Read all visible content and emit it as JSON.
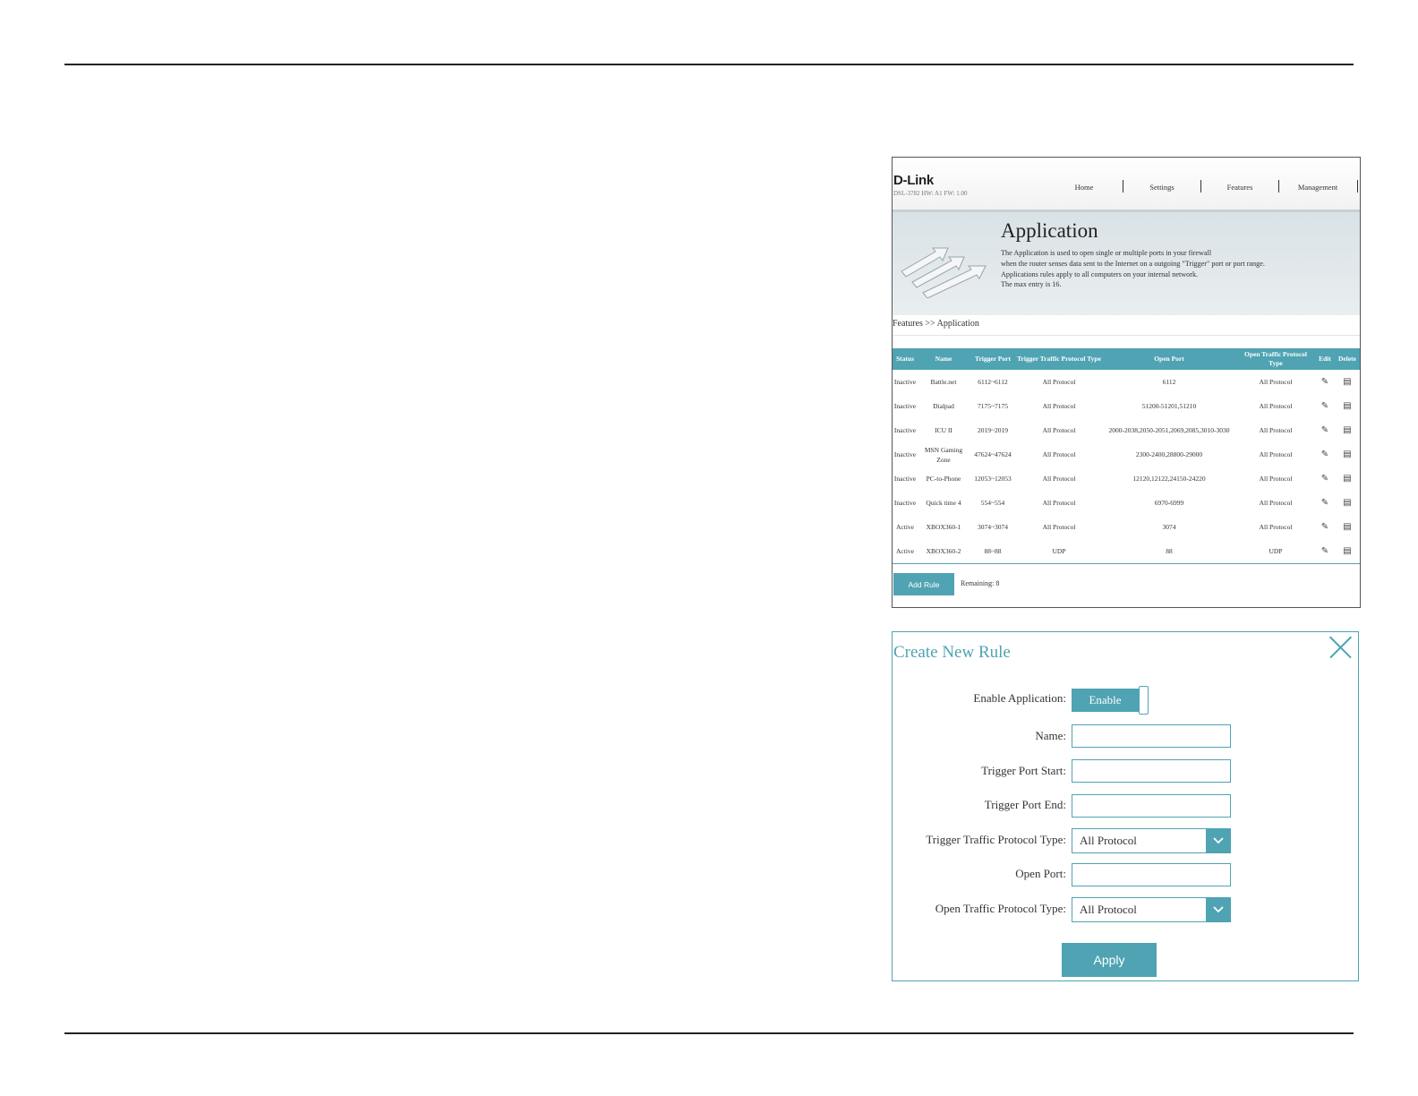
{
  "router": {
    "logo": "D-Link",
    "model": "DSL-3782  HW: A1  FW: 1.00",
    "nav": [
      "Home",
      "Settings",
      "Features",
      "Management"
    ],
    "hero_title": "Application",
    "hero_desc": [
      "The Application is used to open single or multiple ports in your firewall",
      "when the router senses data sent to the Internet on a outgoing \"Trigger\" port or port range.",
      "Applications rules apply to all computers on your internal network.",
      "The max entry is 16."
    ],
    "breadcrumb": "Features >> Application",
    "columns": [
      "Status",
      "Name",
      "Trigger Port",
      "Trigger Traffic Protocol Type",
      "Open Port",
      "Open Traffic Protocol Type",
      "Edit",
      "Delete"
    ],
    "rows": [
      {
        "status": "Inactive",
        "name": "Battle.net",
        "trigger_port": "6112~6112",
        "trigger_proto": "All Protocol",
        "open_port": "6112",
        "open_proto": "All Protocol"
      },
      {
        "status": "Inactive",
        "name": "Dialpad",
        "trigger_port": "7175~7175",
        "trigger_proto": "All Protocol",
        "open_port": "51200-51201,51210",
        "open_proto": "All Protocol"
      },
      {
        "status": "Inactive",
        "name": "ICU II",
        "trigger_port": "2019~2019",
        "trigger_proto": "All Protocol",
        "open_port": "2000-2038,2050-2051,2069,2085,3010-3030",
        "open_proto": "All Protocol"
      },
      {
        "status": "Inactive",
        "name": "MSN Gaming Zone",
        "trigger_port": "47624~47624",
        "trigger_proto": "All Protocol",
        "open_port": "2300-2400,28800-29000",
        "open_proto": "All Protocol"
      },
      {
        "status": "Inactive",
        "name": "PC-to-Phone",
        "trigger_port": "12053~12053",
        "trigger_proto": "All Protocol",
        "open_port": "12120,12122,24150-24220",
        "open_proto": "All Protocol"
      },
      {
        "status": "Inactive",
        "name": "Quick time 4",
        "trigger_port": "554~554",
        "trigger_proto": "All Protocol",
        "open_port": "6970-6999",
        "open_proto": "All Protocol"
      },
      {
        "status": "Active",
        "name": "XBOX360-1",
        "trigger_port": "3074~3074",
        "trigger_proto": "All Protocol",
        "open_port": "3074",
        "open_proto": "All Protocol"
      },
      {
        "status": "Active",
        "name": "XBOX360-2",
        "trigger_port": "88~88",
        "trigger_proto": "UDP",
        "open_port": "88",
        "open_proto": "UDP"
      }
    ],
    "add_rule_label": "Add Rule",
    "remaining": "Remaining: 8"
  },
  "dialog": {
    "title": "Create New Rule",
    "enable_label": "Enable Application:",
    "enable_value": "Enable",
    "name_label": "Name:",
    "trigger_start_label": "Trigger Port Start:",
    "trigger_end_label": "Trigger Port End:",
    "trigger_proto_label": "Trigger Traffic Protocol Type:",
    "trigger_proto_value": "All Protocol",
    "open_port_label": "Open Port:",
    "open_proto_label": "Open Traffic Protocol Type:",
    "open_proto_value": "All Protocol",
    "apply_label": "Apply"
  },
  "colors": {
    "accent": "#4fa3b3",
    "inactive": "#cc2222",
    "active": "#3040a0"
  }
}
